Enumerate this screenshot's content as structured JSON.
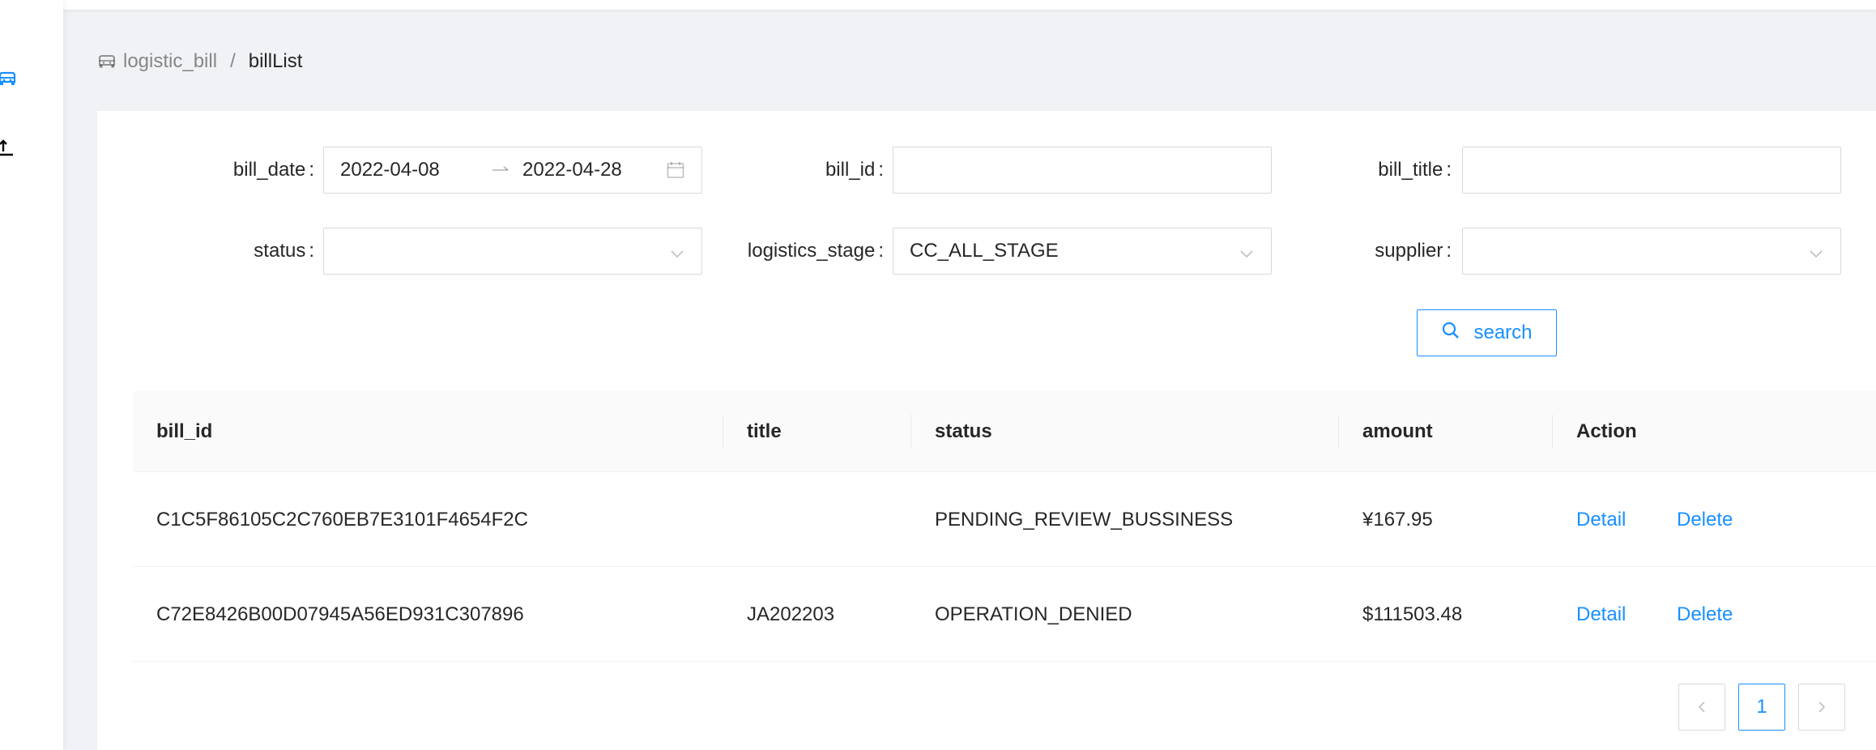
{
  "breadcrumb": {
    "parent": "logistic_bill",
    "separator": "/",
    "current": "billList"
  },
  "form": {
    "bill_date": {
      "label": "bill_date",
      "start": "2022-04-08",
      "end": "2022-04-28"
    },
    "bill_id": {
      "label": "bill_id",
      "value": ""
    },
    "bill_title": {
      "label": "bill_title",
      "value": ""
    },
    "status": {
      "label": "status",
      "value": ""
    },
    "logistics_stage": {
      "label": "logistics_stage",
      "value": "CC_ALL_STAGE"
    },
    "supplier": {
      "label": "supplier",
      "value": ""
    },
    "search_label": "search"
  },
  "table": {
    "columns": [
      "bill_id",
      "title",
      "status",
      "amount",
      "Action"
    ],
    "rows": [
      {
        "bill_id": "C1C5F86105C2C760EB7E3101F4654F2C",
        "title": "",
        "status": "PENDING_REVIEW_BUSSINESS",
        "amount": "¥167.95",
        "detail": "Detail",
        "delete": "Delete"
      },
      {
        "bill_id": "C72E8426B00D07945A56ED931C307896",
        "title": "JA202203",
        "status": "OPERATION_DENIED",
        "amount": "$111503.48",
        "detail": "Detail",
        "delete": "Delete"
      }
    ]
  },
  "pagination": {
    "current_page": "1",
    "prev_icon": "chevron-left-icon",
    "next_icon": "chevron-right-icon"
  },
  "colors": {
    "primary": "#1890ff",
    "background": "#f0f2f5",
    "card": "#ffffff",
    "table_header": "#fafafa"
  },
  "icons": {
    "sider": [
      "car-icon",
      "upload-icon"
    ],
    "breadcrumb": "car-icon",
    "date": "calendar-icon",
    "select": "chevron-down-icon",
    "search": "search-icon"
  }
}
